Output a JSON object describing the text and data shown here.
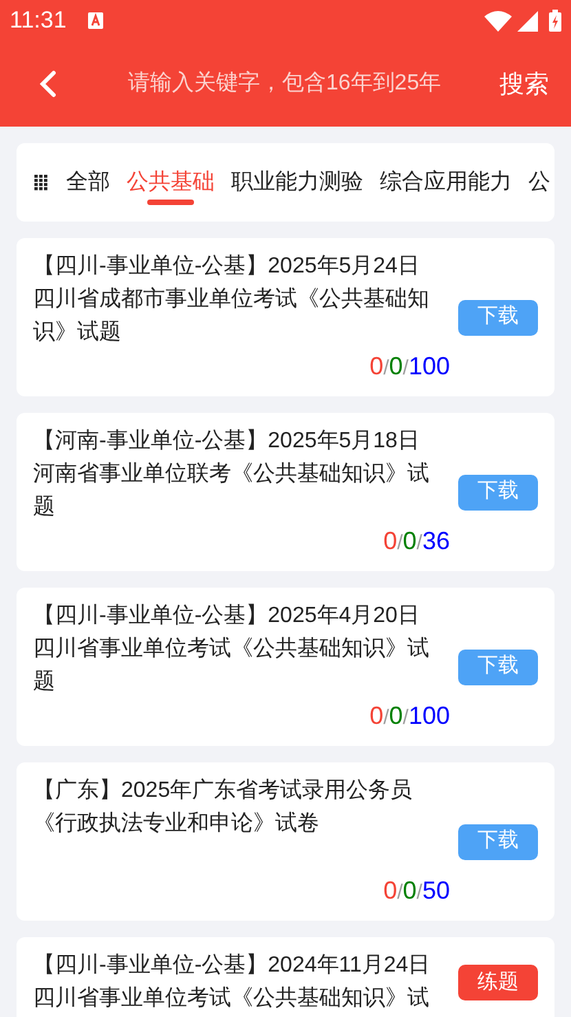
{
  "status_bar": {
    "time": "11:31"
  },
  "header": {
    "search": {
      "placeholder": "请输入关键字，包含16年到25年"
    },
    "search_button": "搜索"
  },
  "tabs": [
    {
      "label": "全部",
      "selected": false
    },
    {
      "label": "公共基础",
      "selected": true
    },
    {
      "label": "职业能力测验",
      "selected": false
    },
    {
      "label": "综合应用能力",
      "selected": false
    },
    {
      "label": "公",
      "selected": false
    }
  ],
  "papers": [
    {
      "title_lines": [
        "【四川-事业单位-公基】2025年5月24日",
        "四川省成都市事业单位考试《公共基础知",
        "识》试题"
      ],
      "stats": [
        {
          "text": "0",
          "color": "#f44336"
        },
        {
          "text": "/",
          "color": "#9e9e9e"
        },
        {
          "text": "0",
          "color": "#008000"
        },
        {
          "text": "/",
          "color": "#9e9e9e"
        },
        {
          "text": "100",
          "color": "#0000ff"
        }
      ],
      "action": {
        "kind": "download",
        "label": "下载"
      }
    },
    {
      "title_lines": [
        "【河南-事业单位-公基】2025年5月18日",
        "河南省事业单位联考《公共基础知识》试",
        "题"
      ],
      "stats": [
        {
          "text": "0",
          "color": "#f44336"
        },
        {
          "text": "/",
          "color": "#9e9e9e"
        },
        {
          "text": "0",
          "color": "#008000"
        },
        {
          "text": "/",
          "color": "#9e9e9e"
        },
        {
          "text": "36",
          "color": "#0000ff"
        }
      ],
      "action": {
        "kind": "download",
        "label": "下载"
      }
    },
    {
      "title_lines": [
        "【四川-事业单位-公基】2025年4月20日",
        "四川省事业单位考试《公共基础知识》试",
        "题"
      ],
      "stats": [
        {
          "text": "0",
          "color": "#f44336"
        },
        {
          "text": "/",
          "color": "#9e9e9e"
        },
        {
          "text": "0",
          "color": "#008000"
        },
        {
          "text": "/",
          "color": "#9e9e9e"
        },
        {
          "text": "100",
          "color": "#0000ff"
        }
      ],
      "action": {
        "kind": "download",
        "label": "下载"
      }
    },
    {
      "title_lines": [
        "【广东】2025年广东省考试录用公务员",
        "《行政执法专业和申论》试卷"
      ],
      "stats": [
        {
          "text": "0",
          "color": "#f44336"
        },
        {
          "text": "/",
          "color": "#9e9e9e"
        },
        {
          "text": "0",
          "color": "#008000"
        },
        {
          "text": "/",
          "color": "#9e9e9e"
        },
        {
          "text": "50",
          "color": "#0000ff"
        }
      ],
      "action": {
        "kind": "download",
        "label": "下载"
      }
    },
    {
      "title_lines": [
        "【四川-事业单位-公基】2024年11月24日",
        "四川省事业单位考试《公共基础知识》试"
      ],
      "action": {
        "kind": "practice",
        "label": "练题"
      }
    }
  ]
}
